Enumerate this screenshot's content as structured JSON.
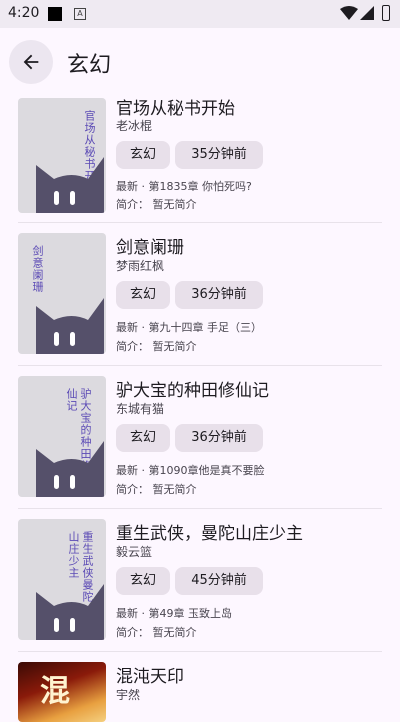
{
  "status": {
    "time": "4:20"
  },
  "header": {
    "title": "玄幻"
  },
  "books": [
    {
      "title": "官场从秘书开始",
      "author": "老冰棍",
      "genre": "玄幻",
      "updated": "35分钟前",
      "latest": "最新 · 第1835章 你怕死吗?",
      "intro": "简介： 暂无简介",
      "cover_text": "官场从秘书开始"
    },
    {
      "title": "剑意阑珊",
      "author": "梦雨红枫",
      "genre": "玄幻",
      "updated": "36分钟前",
      "latest": "最新 · 第九十四章 手足（三）",
      "intro": "简介： 暂无简介",
      "cover_text": "剑意阑珊"
    },
    {
      "title": "驴大宝的种田修仙记",
      "author": "东城有猫",
      "genre": "玄幻",
      "updated": "36分钟前",
      "latest": "最新 · 第1090章他是真不要脸",
      "intro": "简介： 暂无简介",
      "cover_text": "驴大宝的种田修仙记"
    },
    {
      "title": "重生武侠，曼陀山庄少主",
      "author": "毅云篮",
      "genre": "玄幻",
      "updated": "45分钟前",
      "latest": "最新 · 第49章 玉致上岛",
      "intro": "简介： 暂无简介",
      "cover_text": "重生武侠曼陀山庄少主"
    },
    {
      "title": "混沌天印",
      "author": "宇然",
      "cover_text": "混"
    }
  ]
}
